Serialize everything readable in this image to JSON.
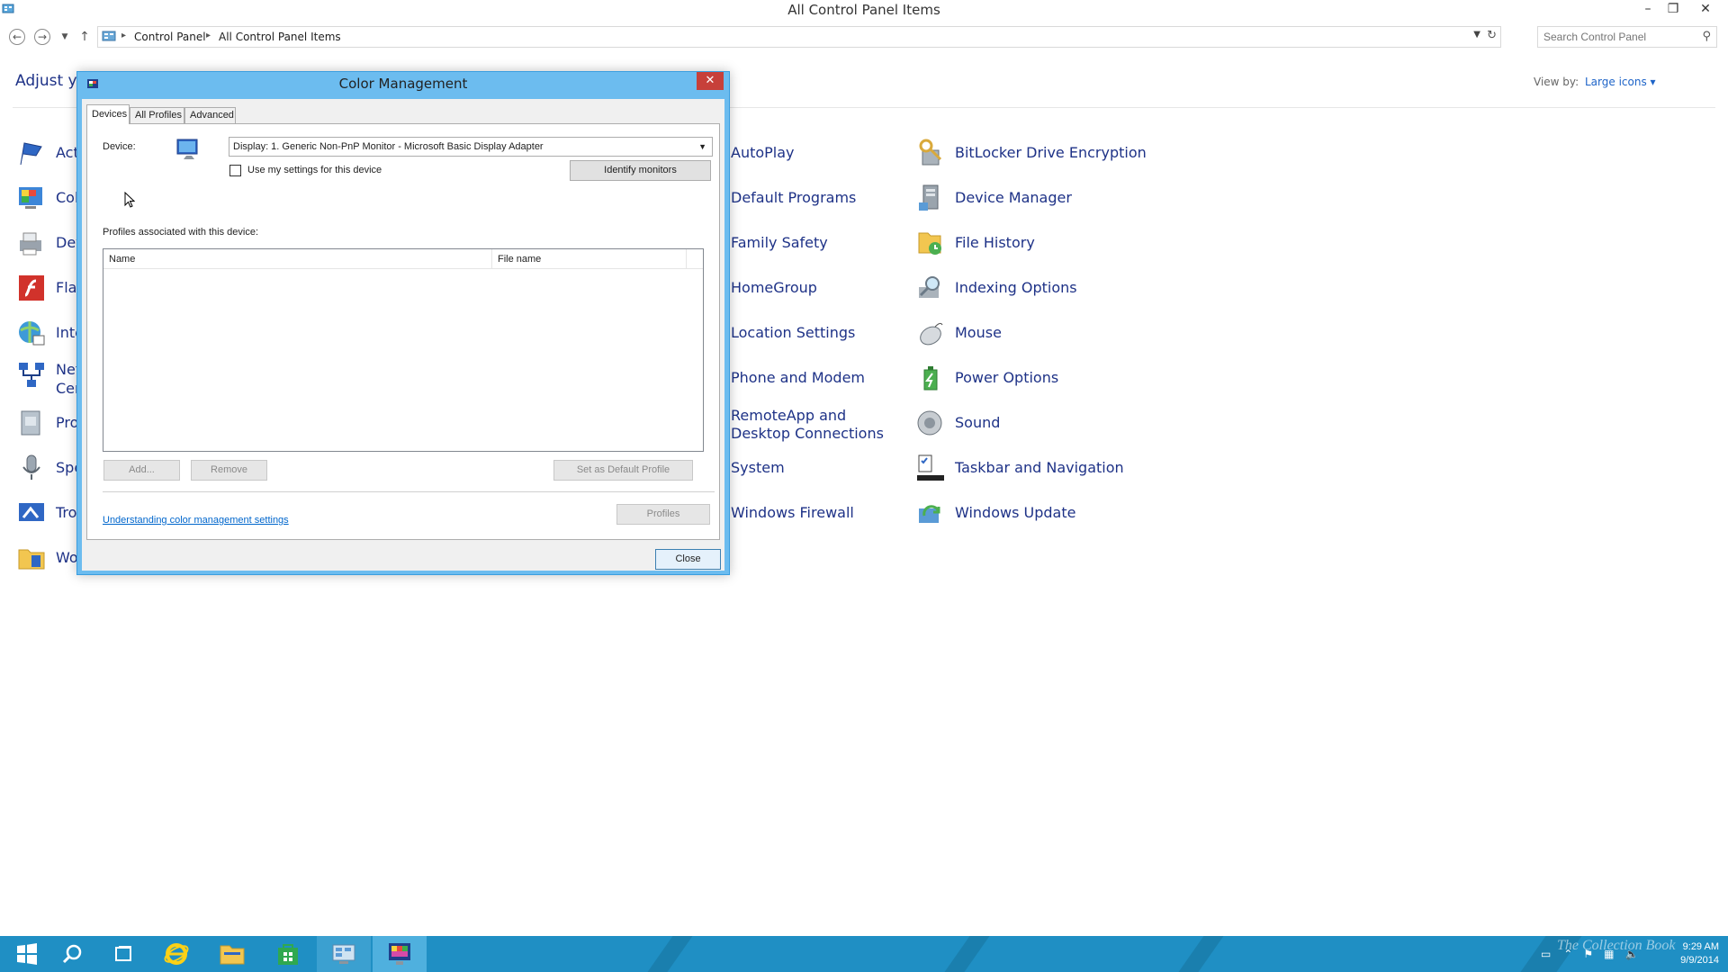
{
  "window": {
    "title": "All Control Panel Items",
    "minimize": "–",
    "restore": "❐",
    "close": "✕"
  },
  "address": {
    "crumbs": [
      "Control Panel",
      "All Control Panel Items"
    ],
    "search_placeholder": "Search Control Panel"
  },
  "content": {
    "heading_partial": "Adjust you",
    "view_by_label": "View by:",
    "view_by_value": "Large icons ▾",
    "left_items_partial": [
      "Act",
      "Col",
      "Dev",
      "Flas",
      "Inte",
      "Net",
      "Cer",
      "Pro",
      "Spe",
      "Tro",
      "Wo"
    ],
    "col3": [
      "AutoPlay",
      "Default Programs",
      "Family Safety",
      "HomeGroup",
      "Location Settings",
      "Phone and Modem",
      "RemoteApp and Desktop Connections",
      "System",
      "Windows Firewall"
    ],
    "col4": [
      "BitLocker Drive Encryption",
      "Device Manager",
      "File History",
      "Indexing Options",
      "Mouse",
      "Power Options",
      "Sound",
      "Taskbar and Navigation",
      "Windows Update"
    ]
  },
  "dialog": {
    "title": "Color Management",
    "close": "✕",
    "tabs": [
      "Devices",
      "All Profiles",
      "Advanced"
    ],
    "active_tab": "Devices",
    "device_label": "Device:",
    "device_value": "Display: 1. Generic Non-PnP Monitor - Microsoft Basic Display Adapter",
    "use_settings_label": "Use my settings for this device",
    "identify_button": "Identify monitors",
    "profiles_label": "Profiles associated with this device:",
    "columns": [
      "Name",
      "File name"
    ],
    "add_button": "Add...",
    "remove_button": "Remove",
    "default_button": "Set as Default Profile",
    "understanding_link": "Understanding color management settings",
    "profiles_button": "Profiles",
    "close_button": "Close"
  },
  "taskbar": {
    "time": "9:29 AM",
    "date": "9/9/2014",
    "watermark": "The Collection Book"
  },
  "colors": {
    "link": "#1e3287",
    "dialog_frame": "#6cbcef",
    "taskbar": "#1f8fc4",
    "close_red": "#c7403a"
  }
}
